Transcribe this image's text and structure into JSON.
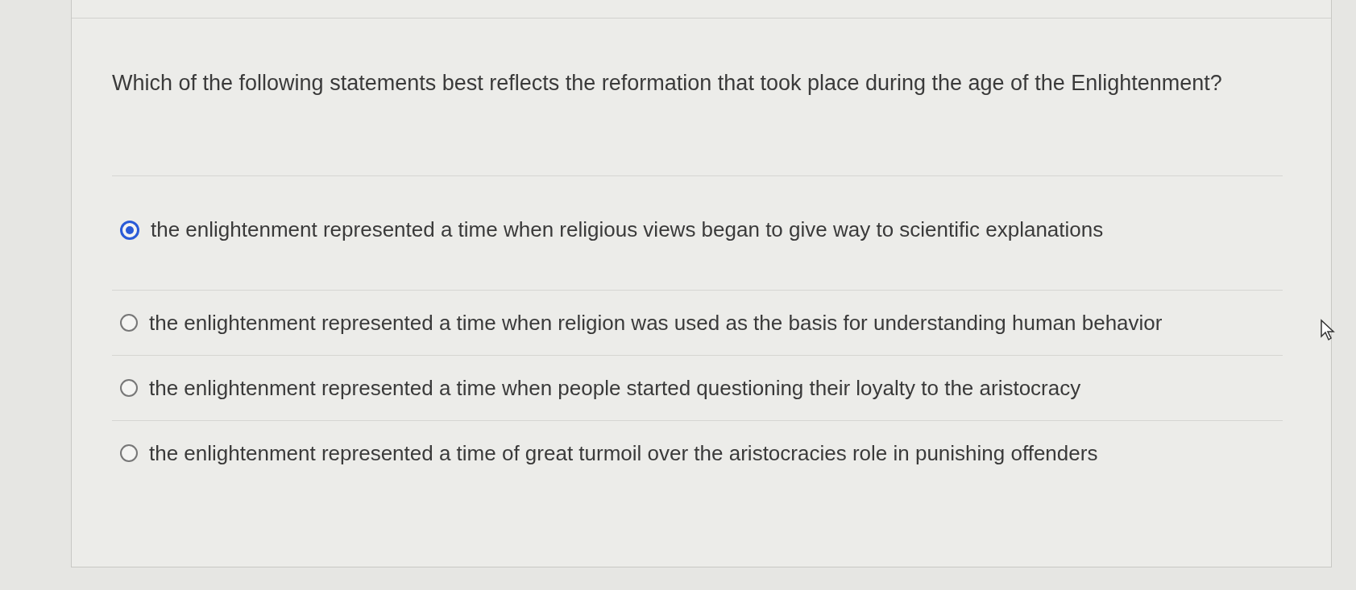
{
  "question": "Which of the following statements best reflects the reformation that took place during the age of the Enlightenment?",
  "options": [
    {
      "text": "the enlightenment represented a time when religious views began to give way to scientific explanations",
      "selected": true
    },
    {
      "text": "the enlightenment represented a time when religion was used as the basis for understanding human behavior",
      "selected": false
    },
    {
      "text": "the enlightenment represented a time when people started questioning their loyalty to the aristocracy",
      "selected": false
    },
    {
      "text": "the enlightenment represented a time of great turmoil over the aristocracies role in punishing offenders",
      "selected": false
    }
  ]
}
